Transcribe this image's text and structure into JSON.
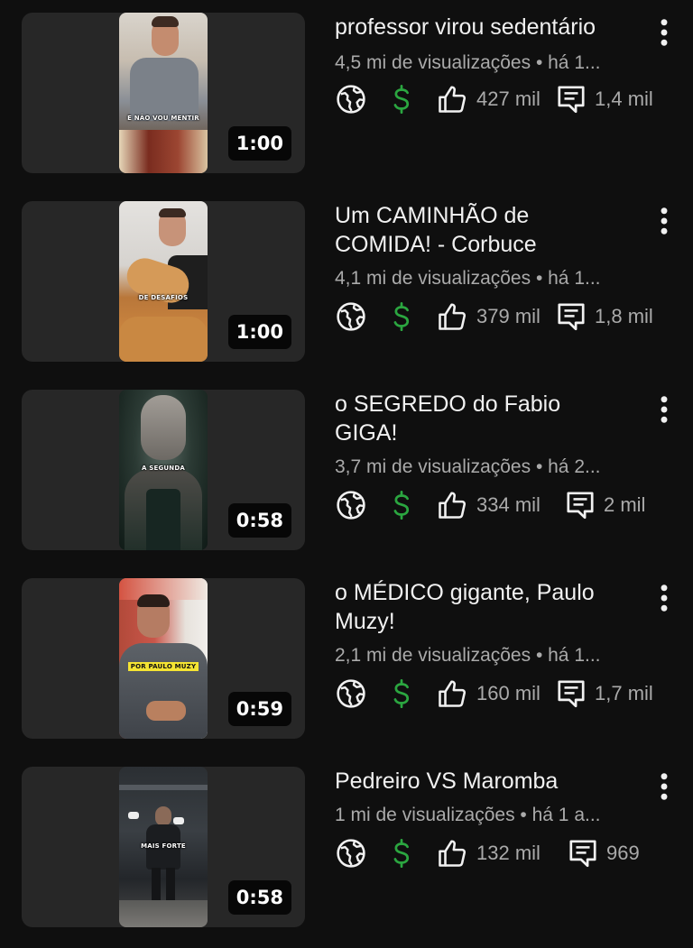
{
  "colors": {
    "background": "#0f0f0f",
    "card": "#272727",
    "title": "#f1f1f1",
    "secondary": "#aaaaaa",
    "monetized": "#2ba640"
  },
  "icons": {
    "visibility": "globe-icon",
    "monetization": "dollar-icon",
    "likes": "thumbs-up-icon",
    "comments": "comment-icon",
    "menu": "more-vert-icon"
  },
  "videos": [
    {
      "title": "professor virou sedentário",
      "meta": "4,5 mi de visualizações • há 1...",
      "duration": "1:00",
      "likes": "427 mil",
      "comments": "1,4 mil",
      "thumb_caption": "E NÃO VOU MENTIR"
    },
    {
      "title": "Um CAMINHÃO de\nCOMIDA! - Corbuce",
      "meta": "4,1 mi de visualizações • há 1...",
      "duration": "1:00",
      "likes": "379 mil",
      "comments": "1,8 mil",
      "thumb_caption": "DE DESAFIOS"
    },
    {
      "title": "o SEGREDO do Fabio\nGIGA!",
      "meta": "3,7 mi de visualizações • há 2...",
      "duration": "0:58",
      "likes": "334 mil",
      "comments": "2 mil",
      "thumb_caption": "A SEGUNDA"
    },
    {
      "title": "o MÉDICO gigante, Paulo\nMuzy!",
      "meta": "2,1 mi de visualizações • há 1...",
      "duration": "0:59",
      "likes": "160 mil",
      "comments": "1,7 mil",
      "thumb_caption": "POR PAULO MUZY"
    },
    {
      "title": "Pedreiro VS Maromba",
      "meta": "1 mi de visualizações • há 1 a...",
      "duration": "0:58",
      "likes": "132 mil",
      "comments": "969",
      "thumb_caption": "MAIS FORTE"
    }
  ]
}
